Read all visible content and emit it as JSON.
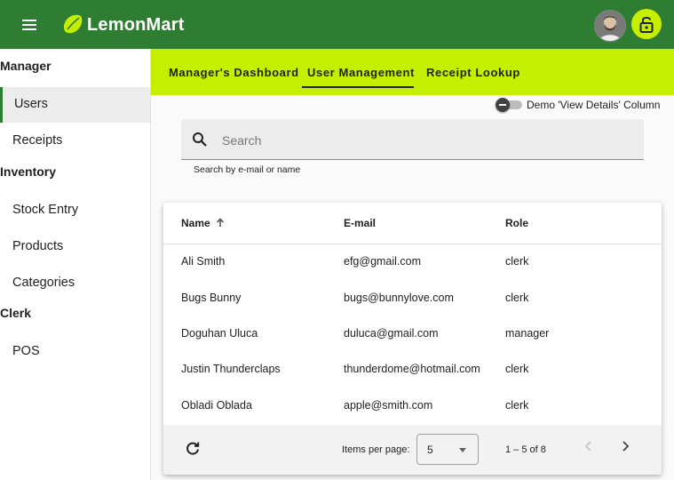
{
  "app": {
    "title": "LemonMart",
    "accent": "#c6ef00",
    "toolbar_color": "#2e7d32"
  },
  "sidebar": {
    "sections": [
      {
        "header": "Manager",
        "items": [
          "Users",
          "Receipts"
        ]
      },
      {
        "header": "Inventory",
        "items": [
          "Stock Entry",
          "Products",
          "Categories"
        ]
      },
      {
        "header": "Clerk",
        "items": [
          "POS"
        ]
      }
    ],
    "active": "Users"
  },
  "tabs": [
    {
      "label": "Manager's Dashboard",
      "active": false
    },
    {
      "label": "User Management",
      "active": true
    },
    {
      "label": "Receipt Lookup",
      "active": false
    }
  ],
  "toggle": {
    "label": "Demo 'View Details' Column",
    "checked": false
  },
  "search": {
    "placeholder": "Search",
    "hint": "Search by e-mail or name",
    "icon": "search-icon"
  },
  "table": {
    "columns": [
      "Name",
      "E-mail",
      "Role"
    ],
    "sort": {
      "column": "Name",
      "direction": "ascending"
    },
    "rows": [
      {
        "name": "Ali Smith",
        "email": "efg@gmail.com",
        "role": "clerk"
      },
      {
        "name": "Bugs Bunny",
        "email": "bugs@bunnylove.com",
        "role": "clerk"
      },
      {
        "name": "Doguhan Uluca",
        "email": "duluca@gmail.com",
        "role": "manager"
      },
      {
        "name": "Justin Thunderclaps",
        "email": "thunderdome@hotmail.com",
        "role": "clerk"
      },
      {
        "name": "Obladi Oblada",
        "email": "apple@smith.com",
        "role": "clerk"
      }
    ]
  },
  "paginator": {
    "items_per_page_label": "Items per page:",
    "page_size": "5",
    "range": "1 – 5 of 8"
  }
}
